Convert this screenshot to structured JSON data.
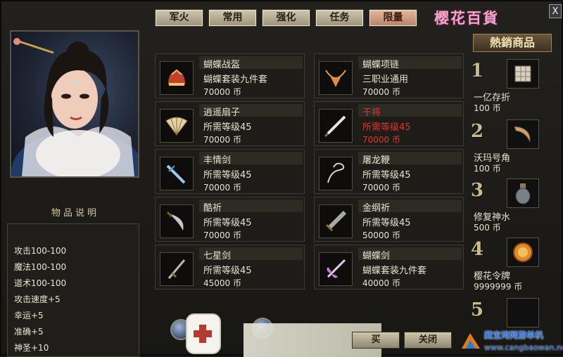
{
  "tabs": [
    {
      "label": "军火"
    },
    {
      "label": "常用"
    },
    {
      "label": "强化"
    },
    {
      "label": "任务"
    },
    {
      "label": "限量"
    }
  ],
  "shop_title": "樱花百貨",
  "close_label": "X",
  "description": {
    "title": "物品说明",
    "stats": [
      "攻击100-100",
      "魔法100-100",
      "道术100-100",
      "攻击速度+5",
      "幸运+5",
      "准确+5",
      "神圣+10"
    ]
  },
  "items": [
    {
      "name": "蝴蝶战盔",
      "line2": "蝴蝶套装九件套",
      "price": "70000 币",
      "icon": "helmet-icon",
      "highlight": false
    },
    {
      "name": "蝴蝶项链",
      "line2": "三职业通用",
      "price": "70000 币",
      "icon": "necklace-icon",
      "highlight": false
    },
    {
      "name": "逍遥扇子",
      "line2": "所需等级45",
      "price": "70000 币",
      "icon": "fan-icon",
      "highlight": false
    },
    {
      "name": "干将",
      "line2": "所需等级45",
      "price": "70000 币",
      "icon": "sword-icon",
      "highlight": true
    },
    {
      "name": "丰情剑",
      "line2": "所需等级45",
      "price": "70000 币",
      "icon": "sword-icon",
      "highlight": false
    },
    {
      "name": "屠龙鞭",
      "line2": "所需等级45",
      "price": "70000 币",
      "icon": "whip-icon",
      "highlight": false
    },
    {
      "name": "酷祈",
      "line2": "所需等级45",
      "price": "70000 币",
      "icon": "blade-icon",
      "highlight": false
    },
    {
      "name": "金纲祈",
      "line2": "所需等级45",
      "price": "50000 币",
      "icon": "greatsword-icon",
      "highlight": false
    },
    {
      "name": "七星剑",
      "line2": "所需等级45",
      "price": "45000 币",
      "icon": "sword-icon",
      "highlight": false
    },
    {
      "name": "蝴蝶剑",
      "line2": "蝴蝶套装九件套",
      "price": "40000 币",
      "icon": "butterfly-sword-icon",
      "highlight": false
    }
  ],
  "hot": {
    "title": "熱銷商品",
    "entries": [
      {
        "num": "1",
        "name": "一亿存折",
        "price": "100 币",
        "icon": "bankbook-icon"
      },
      {
        "num": "2",
        "name": "沃玛号角",
        "price": "100 币",
        "icon": "horn-icon"
      },
      {
        "num": "3",
        "name": "修复神水",
        "price": "500 币",
        "icon": "potion-icon"
      },
      {
        "num": "4",
        "name": "樱花令牌",
        "price": "9999999 币",
        "icon": "token-icon"
      },
      {
        "num": "5",
        "name": "",
        "price": "",
        "icon": "empty-slot-icon"
      }
    ]
  },
  "bottom": {
    "buy_label": "买",
    "close_label": "关闭"
  },
  "watermark": {
    "site_name": "藏宝湾网游单机",
    "url": "www.cangbaowan.net"
  },
  "colors": {
    "highlight_red": "#e0362a",
    "active_tab": "#d2a184",
    "shop_title_pink": "#f2a6c8"
  }
}
